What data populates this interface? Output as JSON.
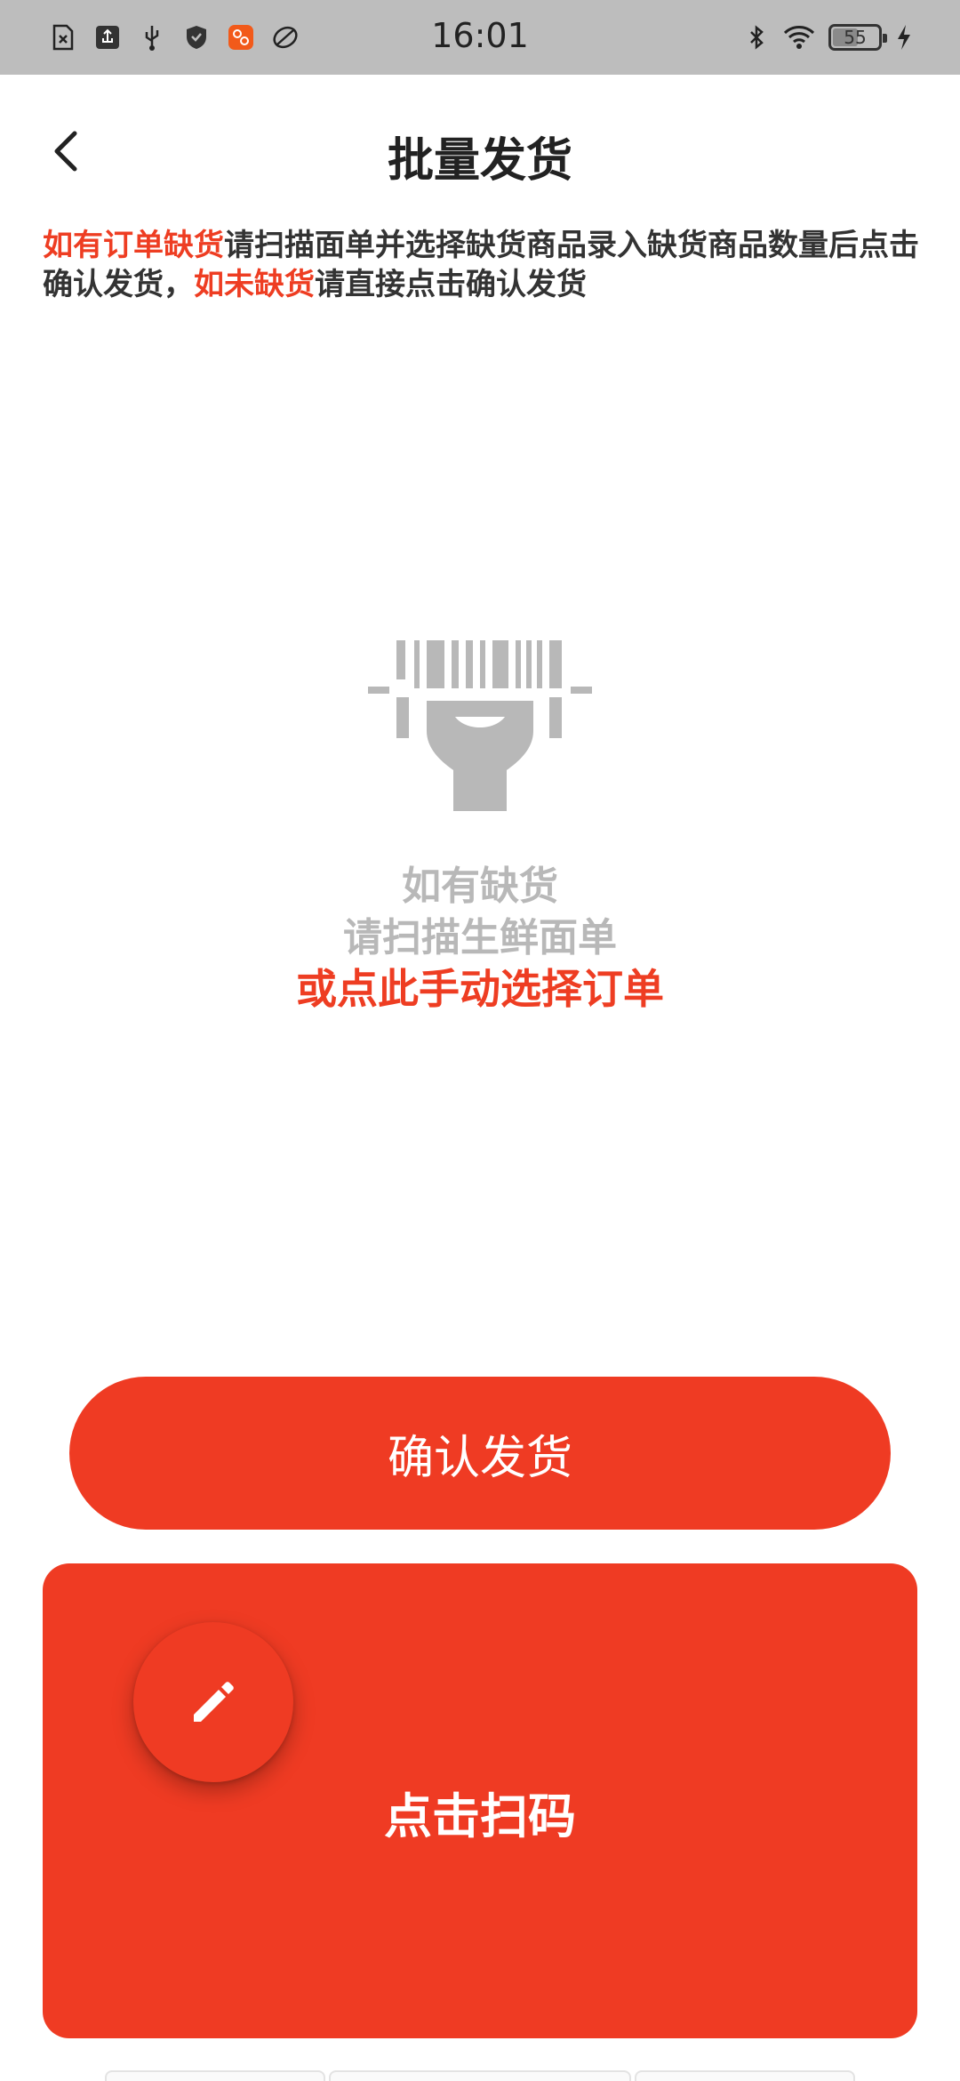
{
  "status_bar": {
    "time": "16:01",
    "battery": "55",
    "left_icons": [
      "sim-card-icon",
      "usb-debug-icon",
      "usb-icon",
      "shield-icon",
      "app-notification-icon",
      "leaf-icon"
    ],
    "right_icons": [
      "bluetooth-icon",
      "wifi-icon",
      "battery-icon",
      "charging-icon"
    ]
  },
  "header": {
    "title": "批量发货",
    "back_icon": "chevron-left-icon"
  },
  "notice": {
    "part1_red": "如有订单缺货",
    "part2": "请扫描面单并选择缺货商品录入缺货商品数量后点击确认发货，",
    "part3_red": "如未缺货",
    "part4": "请直接点击确认发货"
  },
  "hint": {
    "line1": "如有缺货",
    "line2": "请扫描生鲜面单",
    "manual_link": "或点此手动选择订单"
  },
  "confirm_button": {
    "label": "确认发货"
  },
  "scan_panel": {
    "label": "点击扫码",
    "edit_icon": "pencil-icon"
  },
  "colors": {
    "accent": "#ef3b23",
    "status_bar_bg": "#bdbdbd",
    "hint_gray": "#b8b8b8",
    "text_dark": "#333333"
  }
}
